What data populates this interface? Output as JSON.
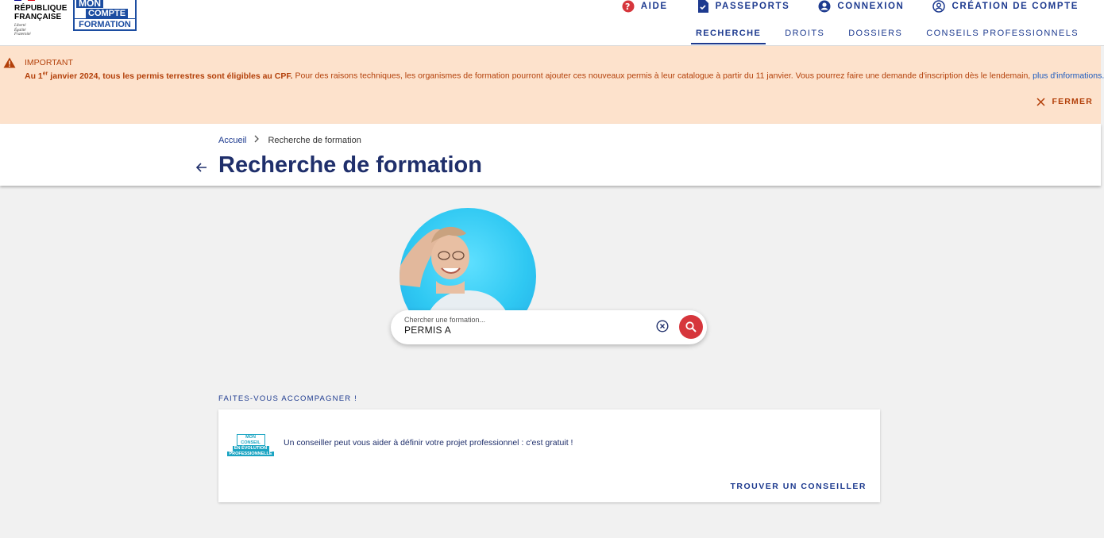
{
  "header": {
    "republique": [
      "RÉPUBLIQUE",
      "FRANÇAISE"
    ],
    "motto": [
      "Liberté",
      "Égalité",
      "Fraternité"
    ],
    "brand": [
      "MON",
      "COMPTE",
      "FORMATION"
    ],
    "top_links": [
      {
        "label": "AIDE",
        "icon": "help-circle-icon"
      },
      {
        "label": "PASSEPORTS",
        "icon": "passport-document-icon"
      },
      {
        "label": "CONNEXION",
        "icon": "account-filled-icon"
      },
      {
        "label": "CRÉATION DE COMPTE",
        "icon": "account-outline-icon"
      }
    ],
    "nav_tabs": [
      {
        "label": "RECHERCHE",
        "active": true
      },
      {
        "label": "DROITS",
        "active": false
      },
      {
        "label": "DOSSIERS",
        "active": false
      },
      {
        "label": "CONSEILS PROFESSIONNELS",
        "active": false
      }
    ]
  },
  "alert": {
    "title": "IMPORTANT",
    "message_prefix": "Au 1",
    "message_sup": "er",
    "message_bold": " janvier 2024, tous les permis terrestres sont éligibles au CPF.",
    "message_rest": " Pour des raisons techniques, les organismes de formation pourront ajouter ces nouveaux permis à leur catalogue à partir du 11 janvier. Vous pourrez faire une demande d'inscription dès le lendemain, ",
    "message_link": "plus d'informations.",
    "close_label": "FERMER"
  },
  "breadcrumb": {
    "home": "Accueil",
    "current": "Recherche de formation"
  },
  "page_title": "Recherche de formation",
  "search": {
    "placeholder": "Chercher une formation...",
    "value": "PERMIS A"
  },
  "accompany": {
    "heading": "FAITES-VOUS ACCOMPAGNER !",
    "logo_lines": [
      "MON CONSEIL",
      "EN ÉVOLUTION",
      "PROFESSIONNELLE"
    ],
    "text": "Un conseiller peut vous aider à définir votre projet professionnel : c'est gratuit !",
    "cta": "TROUVER UN CONSEILLER"
  },
  "colors": {
    "primary": "#1d3a8f",
    "alert_bg": "#fde2cc",
    "alert_text": "#b3400a",
    "search_button": "#d6363c",
    "hero_circle": "#2fc8f2"
  }
}
